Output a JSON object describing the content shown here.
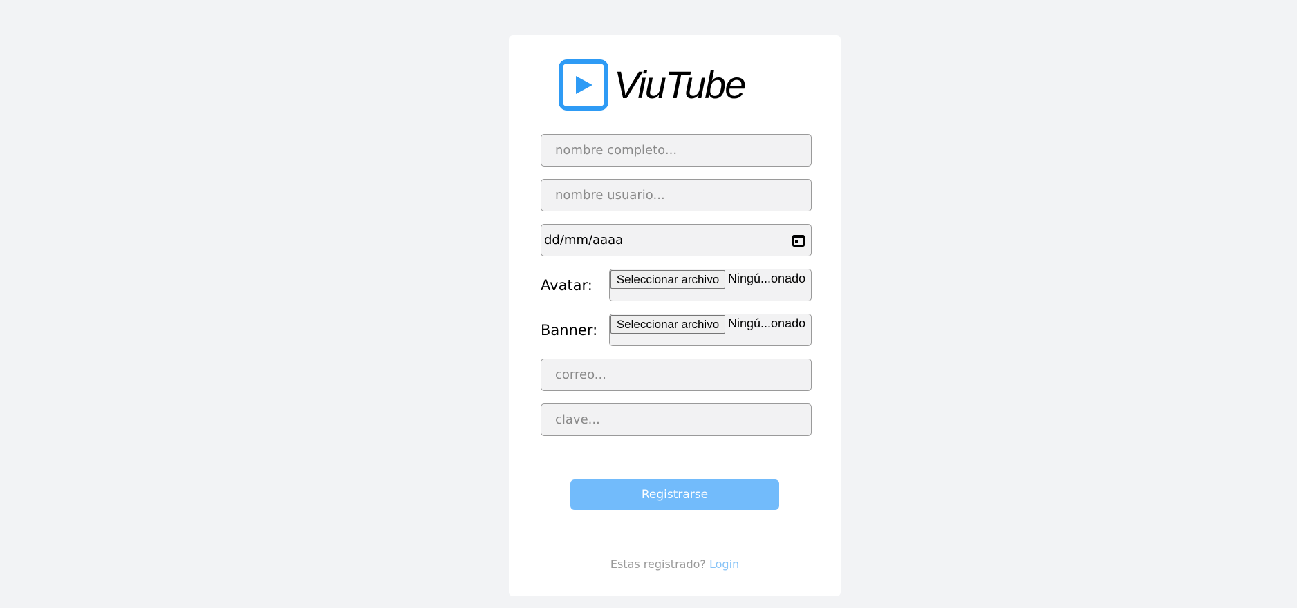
{
  "brand": {
    "name": "ViuTube",
    "accent_color": "#2e9bf5"
  },
  "form": {
    "full_name_placeholder": "nombre completo...",
    "username_placeholder": "nombre usuario...",
    "date_placeholder": "dd/mm/aaaa",
    "date_icon": "calendar-icon",
    "avatar": {
      "label": "Avatar:",
      "button_label": "Seleccionar archivo",
      "status": "Ningú...onado"
    },
    "banner": {
      "label": "Banner:",
      "button_label": "Seleccionar archivo",
      "status": "Ningú...onado"
    },
    "email_placeholder": "correo...",
    "password_placeholder": "clave...",
    "submit_label": "Registrarse",
    "submit_color": "#72bbfb"
  },
  "footer": {
    "prompt": "Estas registrado?",
    "login_link": "Login"
  }
}
